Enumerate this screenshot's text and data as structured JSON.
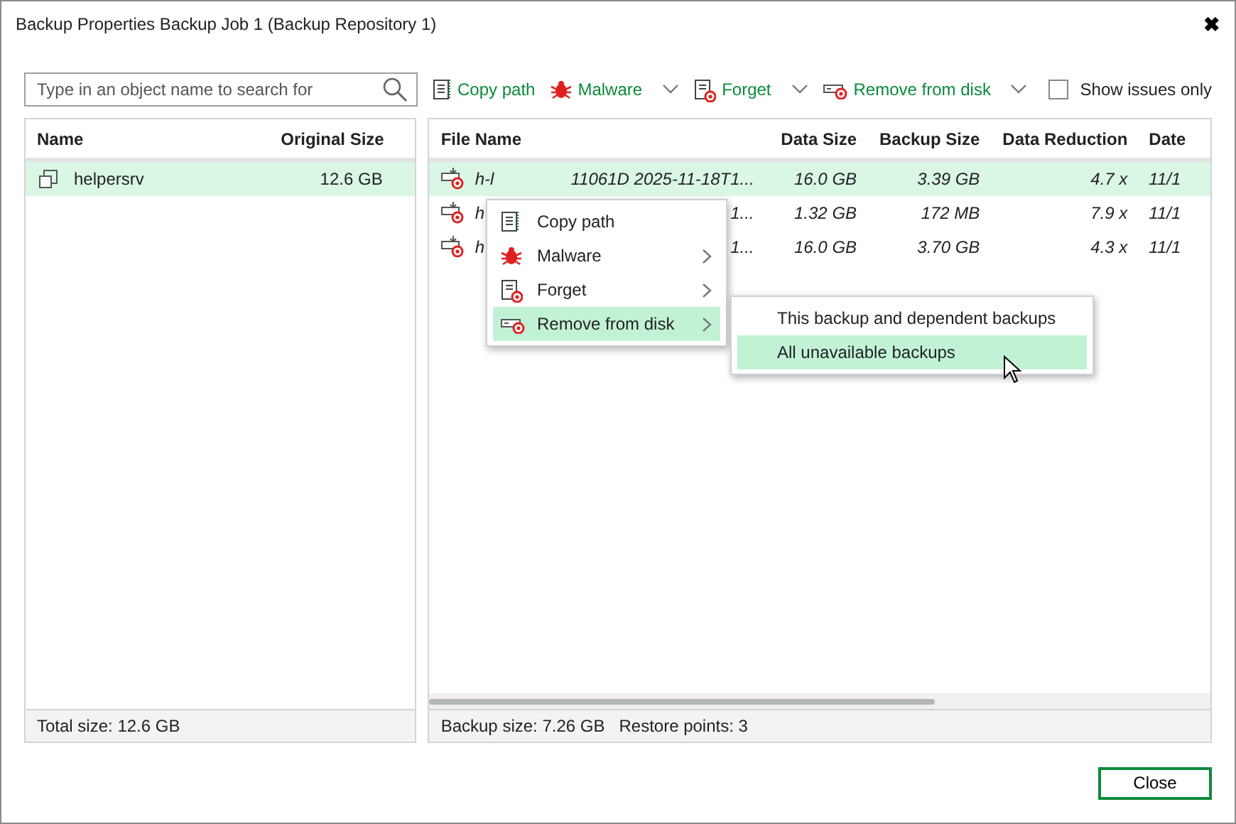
{
  "window": {
    "title": "Backup Properties Backup Job 1 (Backup Repository 1)",
    "close_glyph": "✖"
  },
  "search": {
    "placeholder": "Type in an object name to search for"
  },
  "toolbar": [
    {
      "label": "Copy path",
      "kind": "copy",
      "dropdown": false
    },
    {
      "label": "Malware",
      "kind": "malware",
      "dropdown": true
    },
    {
      "label": "Forget",
      "kind": "forget",
      "dropdown": true
    },
    {
      "label": "Remove from disk",
      "kind": "remove",
      "dropdown": true
    }
  ],
  "show_issues_only": {
    "label": "Show issues only",
    "checked": false
  },
  "objects": {
    "columns": [
      "Name",
      "Original Size"
    ],
    "rows": [
      {
        "name": "helpersrv",
        "size": "12.6 GB",
        "selected": true
      }
    ],
    "footer": "Total size: 12.6 GB"
  },
  "files": {
    "columns": [
      "File Name",
      "Data Size",
      "Backup Size",
      "Data Reduction",
      "Date"
    ],
    "rows": [
      {
        "name_start": "h-l",
        "name_end": "11061D 2025-11-18T1...",
        "data_size": "16.0 GB",
        "backup_size": "3.39 GB",
        "reduction": "4.7 x",
        "date": "11/1",
        "selected": true
      },
      {
        "name_start": "h",
        "name_end": "1...",
        "data_size": "1.32 GB",
        "backup_size": "172 MB",
        "reduction": "7.9 x",
        "date": "11/1",
        "selected": false
      },
      {
        "name_start": "h",
        "name_end": "1...",
        "data_size": "16.0 GB",
        "backup_size": "3.70 GB",
        "reduction": "4.3 x",
        "date": "11/1",
        "selected": false
      }
    ],
    "footer": [
      "Backup size: 7.26 GB",
      "Restore points: 3"
    ]
  },
  "context_menu": [
    {
      "label": "Copy path",
      "kind": "copy",
      "submenu": false,
      "selected": false
    },
    {
      "label": "Malware",
      "kind": "malware",
      "submenu": true,
      "selected": false
    },
    {
      "label": "Forget",
      "kind": "forget",
      "submenu": true,
      "selected": false
    },
    {
      "label": "Remove from disk",
      "kind": "remove",
      "submenu": true,
      "selected": true
    }
  ],
  "submenu": [
    {
      "label": "This backup and dependent backups",
      "selected": false
    },
    {
      "label": "All unavailable backups",
      "selected": true
    }
  ],
  "buttons": [
    "Close"
  ]
}
